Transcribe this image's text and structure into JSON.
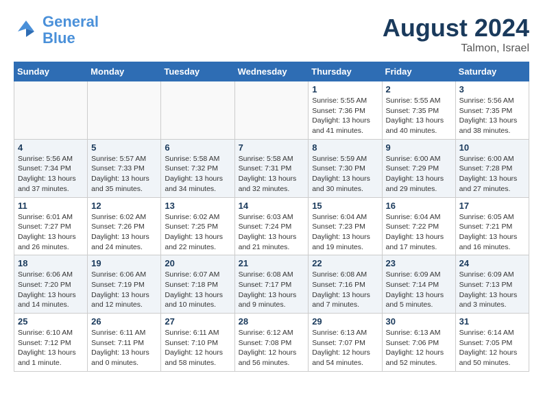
{
  "logo": {
    "general": "General",
    "blue": "Blue"
  },
  "header": {
    "title": "August 2024",
    "subtitle": "Talmon, Israel"
  },
  "days_of_week": [
    "Sunday",
    "Monday",
    "Tuesday",
    "Wednesday",
    "Thursday",
    "Friday",
    "Saturday"
  ],
  "weeks": [
    [
      {
        "day": "",
        "info": ""
      },
      {
        "day": "",
        "info": ""
      },
      {
        "day": "",
        "info": ""
      },
      {
        "day": "",
        "info": ""
      },
      {
        "day": "1",
        "info": "Sunrise: 5:55 AM\nSunset: 7:36 PM\nDaylight: 13 hours\nand 41 minutes."
      },
      {
        "day": "2",
        "info": "Sunrise: 5:55 AM\nSunset: 7:35 PM\nDaylight: 13 hours\nand 40 minutes."
      },
      {
        "day": "3",
        "info": "Sunrise: 5:56 AM\nSunset: 7:35 PM\nDaylight: 13 hours\nand 38 minutes."
      }
    ],
    [
      {
        "day": "4",
        "info": "Sunrise: 5:56 AM\nSunset: 7:34 PM\nDaylight: 13 hours\nand 37 minutes."
      },
      {
        "day": "5",
        "info": "Sunrise: 5:57 AM\nSunset: 7:33 PM\nDaylight: 13 hours\nand 35 minutes."
      },
      {
        "day": "6",
        "info": "Sunrise: 5:58 AM\nSunset: 7:32 PM\nDaylight: 13 hours\nand 34 minutes."
      },
      {
        "day": "7",
        "info": "Sunrise: 5:58 AM\nSunset: 7:31 PM\nDaylight: 13 hours\nand 32 minutes."
      },
      {
        "day": "8",
        "info": "Sunrise: 5:59 AM\nSunset: 7:30 PM\nDaylight: 13 hours\nand 30 minutes."
      },
      {
        "day": "9",
        "info": "Sunrise: 6:00 AM\nSunset: 7:29 PM\nDaylight: 13 hours\nand 29 minutes."
      },
      {
        "day": "10",
        "info": "Sunrise: 6:00 AM\nSunset: 7:28 PM\nDaylight: 13 hours\nand 27 minutes."
      }
    ],
    [
      {
        "day": "11",
        "info": "Sunrise: 6:01 AM\nSunset: 7:27 PM\nDaylight: 13 hours\nand 26 minutes."
      },
      {
        "day": "12",
        "info": "Sunrise: 6:02 AM\nSunset: 7:26 PM\nDaylight: 13 hours\nand 24 minutes."
      },
      {
        "day": "13",
        "info": "Sunrise: 6:02 AM\nSunset: 7:25 PM\nDaylight: 13 hours\nand 22 minutes."
      },
      {
        "day": "14",
        "info": "Sunrise: 6:03 AM\nSunset: 7:24 PM\nDaylight: 13 hours\nand 21 minutes."
      },
      {
        "day": "15",
        "info": "Sunrise: 6:04 AM\nSunset: 7:23 PM\nDaylight: 13 hours\nand 19 minutes."
      },
      {
        "day": "16",
        "info": "Sunrise: 6:04 AM\nSunset: 7:22 PM\nDaylight: 13 hours\nand 17 minutes."
      },
      {
        "day": "17",
        "info": "Sunrise: 6:05 AM\nSunset: 7:21 PM\nDaylight: 13 hours\nand 16 minutes."
      }
    ],
    [
      {
        "day": "18",
        "info": "Sunrise: 6:06 AM\nSunset: 7:20 PM\nDaylight: 13 hours\nand 14 minutes."
      },
      {
        "day": "19",
        "info": "Sunrise: 6:06 AM\nSunset: 7:19 PM\nDaylight: 13 hours\nand 12 minutes."
      },
      {
        "day": "20",
        "info": "Sunrise: 6:07 AM\nSunset: 7:18 PM\nDaylight: 13 hours\nand 10 minutes."
      },
      {
        "day": "21",
        "info": "Sunrise: 6:08 AM\nSunset: 7:17 PM\nDaylight: 13 hours\nand 9 minutes."
      },
      {
        "day": "22",
        "info": "Sunrise: 6:08 AM\nSunset: 7:16 PM\nDaylight: 13 hours\nand 7 minutes."
      },
      {
        "day": "23",
        "info": "Sunrise: 6:09 AM\nSunset: 7:14 PM\nDaylight: 13 hours\nand 5 minutes."
      },
      {
        "day": "24",
        "info": "Sunrise: 6:09 AM\nSunset: 7:13 PM\nDaylight: 13 hours\nand 3 minutes."
      }
    ],
    [
      {
        "day": "25",
        "info": "Sunrise: 6:10 AM\nSunset: 7:12 PM\nDaylight: 13 hours\nand 1 minute."
      },
      {
        "day": "26",
        "info": "Sunrise: 6:11 AM\nSunset: 7:11 PM\nDaylight: 13 hours\nand 0 minutes."
      },
      {
        "day": "27",
        "info": "Sunrise: 6:11 AM\nSunset: 7:10 PM\nDaylight: 12 hours\nand 58 minutes."
      },
      {
        "day": "28",
        "info": "Sunrise: 6:12 AM\nSunset: 7:08 PM\nDaylight: 12 hours\nand 56 minutes."
      },
      {
        "day": "29",
        "info": "Sunrise: 6:13 AM\nSunset: 7:07 PM\nDaylight: 12 hours\nand 54 minutes."
      },
      {
        "day": "30",
        "info": "Sunrise: 6:13 AM\nSunset: 7:06 PM\nDaylight: 12 hours\nand 52 minutes."
      },
      {
        "day": "31",
        "info": "Sunrise: 6:14 AM\nSunset: 7:05 PM\nDaylight: 12 hours\nand 50 minutes."
      }
    ]
  ]
}
